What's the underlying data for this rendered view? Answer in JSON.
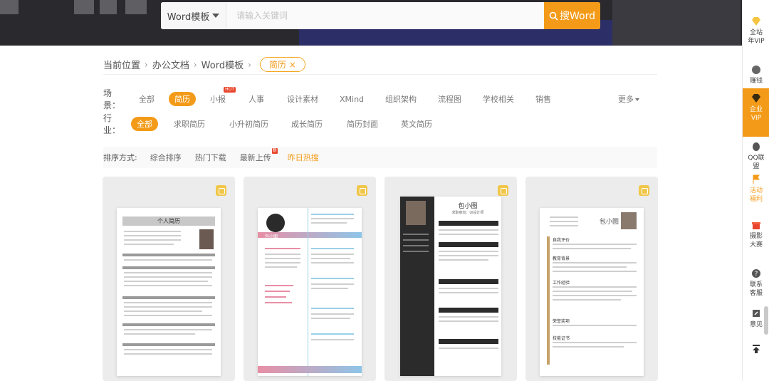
{
  "search": {
    "scope_label": "Word模板",
    "placeholder": "请输入关键词",
    "button_label": "搜Word"
  },
  "breadcrumb": {
    "items": [
      "当前位置",
      "办公文档",
      "Word模板"
    ],
    "current_tag": "简历 ×"
  },
  "filters": {
    "scene": {
      "label": "场景：",
      "items": [
        "全部",
        "简历",
        "小报",
        "人事",
        "设计素材",
        "XMind",
        "组织架构",
        "流程图",
        "学校相关",
        "销售"
      ],
      "hot_badge": "HOT",
      "more": "更多"
    },
    "industry": {
      "label": "行业：",
      "items": [
        "全部",
        "求职简历",
        "小升初简历",
        "成长简历",
        "简历封面",
        "英文简历"
      ]
    }
  },
  "sort": {
    "label": "排序方式:",
    "items": [
      "综合排序",
      "热门下载",
      "最新上传",
      "昨日热搜"
    ],
    "new_badge": "新"
  },
  "cards": [
    {
      "title": "个人简历"
    },
    {
      "name": "包小图"
    },
    {
      "name": "包小图",
      "subtitle": "求职意向：UI设计师"
    },
    {
      "name": "包小图",
      "sections": [
        "自我评价",
        "教育背景",
        "工作经验",
        "荣誉奖项",
        "技能证书"
      ]
    }
  ],
  "sidebar": {
    "items": [
      "全站年VIP",
      "赚钱",
      "企业VIP",
      "QQ联盟",
      "活动福利",
      "摄影大赛",
      "联系客服",
      "意见"
    ]
  },
  "colors": {
    "accent": "#f39b19",
    "banner": "#2a2a2e"
  }
}
